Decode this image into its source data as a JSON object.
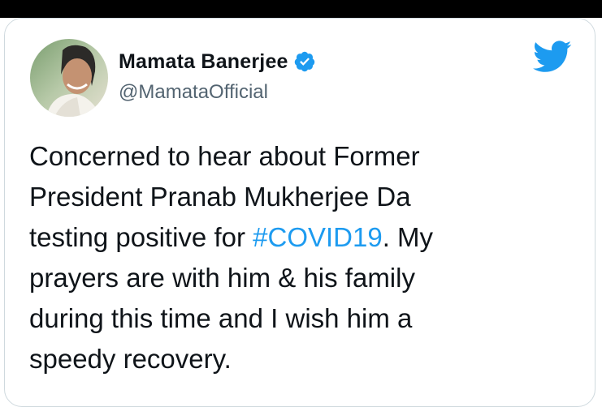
{
  "author": {
    "display_name": "Mamata Banerjee",
    "handle": "@MamataOfficial",
    "verified_icon": "verified-badge-icon",
    "avatar_icon": "profile-avatar"
  },
  "brand": {
    "logo_icon": "twitter-bird-icon",
    "accent_color": "#1d9bf0"
  },
  "tweet": {
    "lines": [
      {
        "text": "Concerned to hear about Former"
      },
      {
        "text": "President Pranab Mukherjee Da"
      },
      {
        "before": "testing positive for ",
        "hashtag": "#COVID19",
        "after": ". My"
      },
      {
        "text": "prayers are with him & his family"
      },
      {
        "text": "during this time and I wish him a"
      },
      {
        "text": "speedy recovery."
      }
    ]
  }
}
